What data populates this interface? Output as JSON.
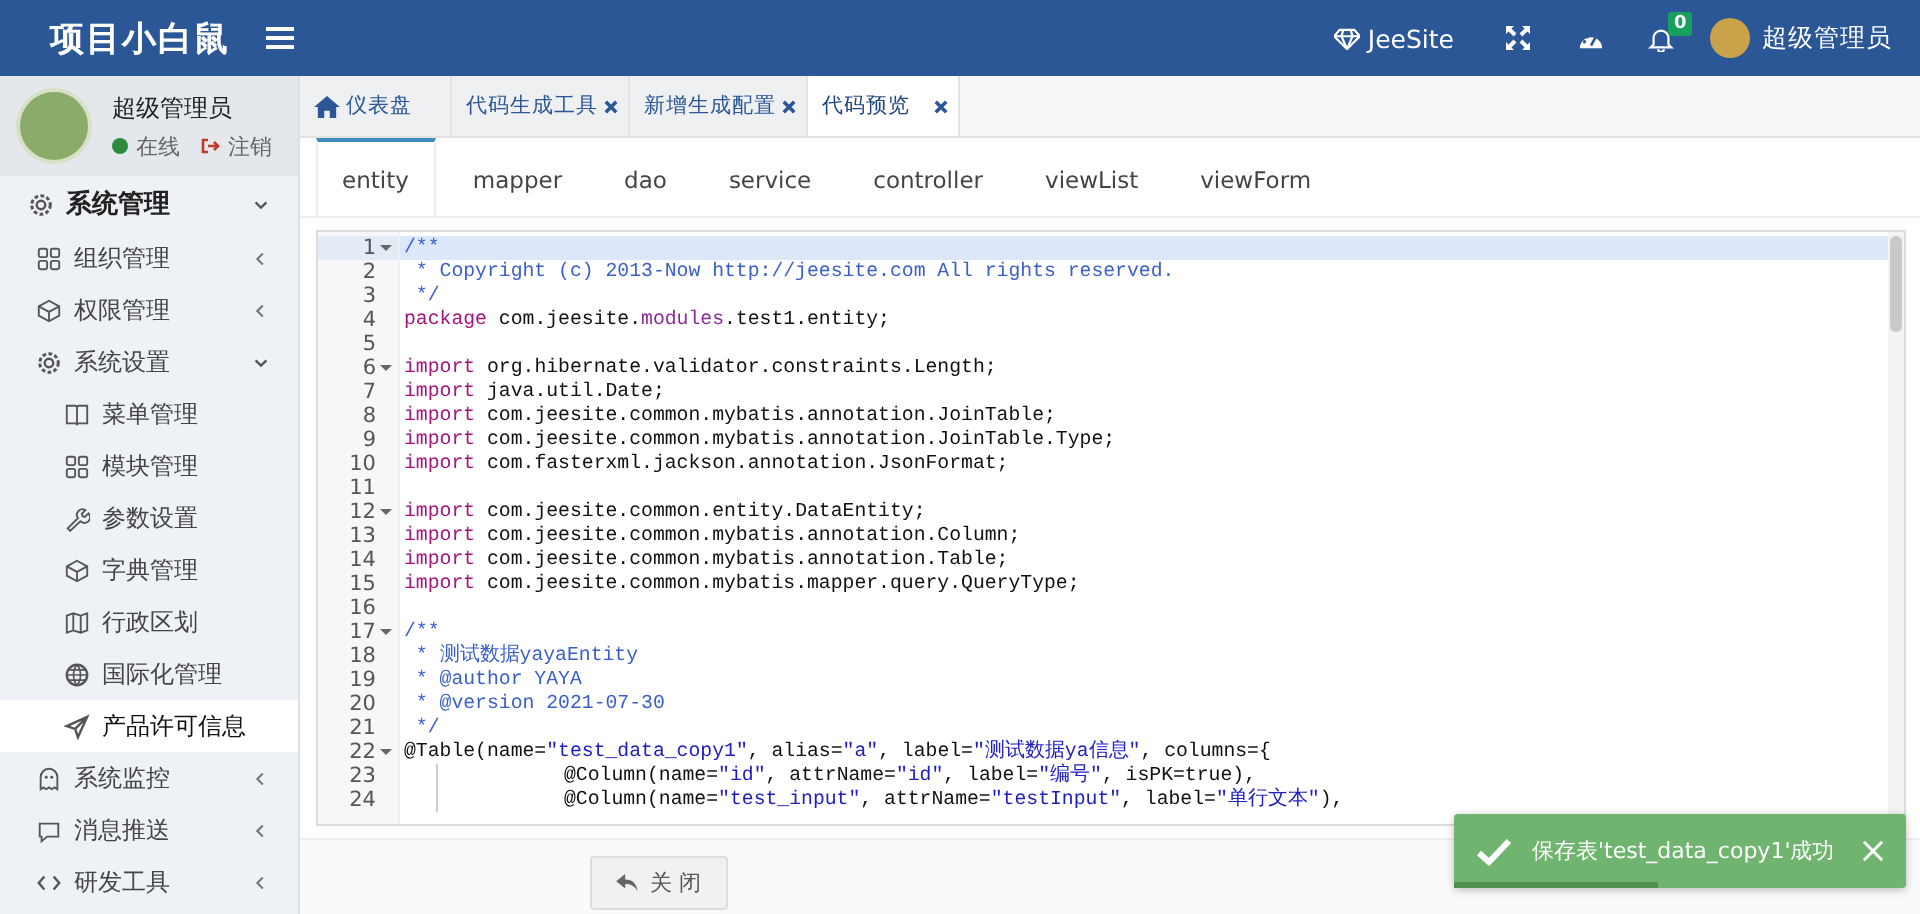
{
  "header": {
    "logo": "项目小白鼠",
    "site": "JeeSite",
    "notifications": "0",
    "user": "超级管理员"
  },
  "sidebar": {
    "user": {
      "name": "超级管理员",
      "status": "在线",
      "online": true,
      "logout": "注销"
    },
    "menu": [
      {
        "label": "系统管理",
        "kind": "gear",
        "expanded": true,
        "children": [
          {
            "label": "组织管理",
            "kind": "grid",
            "expanded": false
          },
          {
            "label": "权限管理",
            "kind": "cube",
            "expanded": false
          },
          {
            "label": "系统设置",
            "kind": "gear",
            "expanded": true,
            "children": [
              {
                "label": "菜单管理",
                "kind": "book",
                "selected": false
              },
              {
                "label": "模块管理",
                "kind": "grid",
                "selected": false
              },
              {
                "label": "参数设置",
                "kind": "wrench",
                "selected": false
              },
              {
                "label": "字典管理",
                "kind": "cube",
                "selected": false
              },
              {
                "label": "行政区划",
                "kind": "map",
                "selected": false
              },
              {
                "label": "国际化管理",
                "kind": "globe",
                "selected": false
              },
              {
                "label": "产品许可信息",
                "kind": "send",
                "selected": true
              }
            ]
          },
          {
            "label": "系统监控",
            "kind": "ghost",
            "expanded": false
          },
          {
            "label": "消息推送",
            "kind": "chat",
            "expanded": false
          },
          {
            "label": "研发工具",
            "kind": "code",
            "expanded": false
          }
        ]
      }
    ]
  },
  "tabs": [
    {
      "label": "仪表盘",
      "home": true,
      "closable": false,
      "selected": false
    },
    {
      "label": "代码生成工具",
      "home": false,
      "closable": true,
      "selected": false
    },
    {
      "label": "新增生成配置",
      "home": false,
      "closable": true,
      "selected": false
    },
    {
      "label": "代码预览",
      "home": false,
      "closable": true,
      "selected": true
    }
  ],
  "code_tabs": [
    {
      "label": "entity",
      "selected": true
    },
    {
      "label": "mapper",
      "selected": false
    },
    {
      "label": "dao",
      "selected": false
    },
    {
      "label": "service",
      "selected": false
    },
    {
      "label": "controller",
      "selected": false
    },
    {
      "label": "viewList",
      "selected": false
    },
    {
      "label": "viewForm",
      "selected": false
    }
  ],
  "editor": {
    "lines": [
      {
        "n": "1",
        "fold": true,
        "current": true,
        "indented": false,
        "tokens": [
          {
            "kind": "cm",
            "t": "/**"
          }
        ]
      },
      {
        "n": "2",
        "fold": false,
        "current": false,
        "indented": false,
        "tokens": [
          {
            "kind": "cm",
            "t": " * Copyright (c) 2013-Now http://jeesite.com All rights reserved."
          }
        ]
      },
      {
        "n": "3",
        "fold": false,
        "current": false,
        "indented": false,
        "tokens": [
          {
            "kind": "cm",
            "t": " */"
          }
        ]
      },
      {
        "n": "4",
        "fold": false,
        "current": false,
        "indented": false,
        "tokens": [
          {
            "kind": "kw",
            "t": "package"
          },
          {
            "kind": "p",
            "t": " com.jeesite."
          },
          {
            "kind": "mod",
            "t": "modules"
          },
          {
            "kind": "p",
            "t": ".test1.entity;"
          }
        ]
      },
      {
        "n": "5",
        "fold": false,
        "current": false,
        "indented": false
      },
      {
        "n": "6",
        "fold": true,
        "current": false,
        "indented": false,
        "tokens": [
          {
            "kind": "kw",
            "t": "import"
          },
          {
            "kind": "p",
            "t": " org.hibernate.validator.constraints.Length;"
          }
        ]
      },
      {
        "n": "7",
        "fold": false,
        "current": false,
        "indented": false,
        "tokens": [
          {
            "kind": "kw",
            "t": "import"
          },
          {
            "kind": "p",
            "t": " java.util.Date;"
          }
        ]
      },
      {
        "n": "8",
        "fold": false,
        "current": false,
        "indented": false,
        "tokens": [
          {
            "kind": "kw",
            "t": "import"
          },
          {
            "kind": "p",
            "t": " com.jeesite.common.mybatis.annotation.JoinTable;"
          }
        ]
      },
      {
        "n": "9",
        "fold": false,
        "current": false,
        "indented": false,
        "tokens": [
          {
            "kind": "kw",
            "t": "import"
          },
          {
            "kind": "p",
            "t": " com.jeesite.common.mybatis.annotation.JoinTable.Type;"
          }
        ]
      },
      {
        "n": "10",
        "fold": false,
        "current": false,
        "indented": false,
        "tokens": [
          {
            "kind": "kw",
            "t": "import"
          },
          {
            "kind": "p",
            "t": " com.fasterxml.jackson.annotation.JsonFormat;"
          }
        ]
      },
      {
        "n": "11",
        "fold": false,
        "current": false,
        "indented": false
      },
      {
        "n": "12",
        "fold": true,
        "current": false,
        "indented": false,
        "tokens": [
          {
            "kind": "kw",
            "t": "import"
          },
          {
            "kind": "p",
            "t": " com.jeesite.common.entity.DataEntity;"
          }
        ]
      },
      {
        "n": "13",
        "fold": false,
        "current": false,
        "indented": false,
        "tokens": [
          {
            "kind": "kw",
            "t": "import"
          },
          {
            "kind": "p",
            "t": " com.jeesite.common.mybatis.annotation.Column;"
          }
        ]
      },
      {
        "n": "14",
        "fold": false,
        "current": false,
        "indented": false,
        "tokens": [
          {
            "kind": "kw",
            "t": "import"
          },
          {
            "kind": "p",
            "t": " com.jeesite.common.mybatis.annotation.Table;"
          }
        ]
      },
      {
        "n": "15",
        "fold": false,
        "current": false,
        "indented": false,
        "tokens": [
          {
            "kind": "kw",
            "t": "import"
          },
          {
            "kind": "p",
            "t": " com.jeesite.common.mybatis.mapper.query.QueryType;"
          }
        ]
      },
      {
        "n": "16",
        "fold": false,
        "current": false,
        "indented": false
      },
      {
        "n": "17",
        "fold": true,
        "current": false,
        "indented": false,
        "tokens": [
          {
            "kind": "cm",
            "t": "/**"
          }
        ]
      },
      {
        "n": "18",
        "fold": false,
        "current": false,
        "indented": false,
        "tokens": [
          {
            "kind": "cm",
            "t": " * 测试数据yayaEntity"
          }
        ]
      },
      {
        "n": "19",
        "fold": false,
        "current": false,
        "indented": false,
        "tokens": [
          {
            "kind": "cm",
            "t": " * @author YAYA"
          }
        ]
      },
      {
        "n": "20",
        "fold": false,
        "current": false,
        "indented": false,
        "tokens": [
          {
            "kind": "cm",
            "t": " * @version 2021-07-30"
          }
        ]
      },
      {
        "n": "21",
        "fold": false,
        "current": false,
        "indented": false,
        "tokens": [
          {
            "kind": "cm",
            "t": " */"
          }
        ]
      },
      {
        "n": "22",
        "fold": true,
        "current": false,
        "indented": false,
        "tokens": [
          {
            "kind": "p",
            "t": "@Table(name="
          },
          {
            "kind": "str",
            "t": "\"test_data_copy1\""
          },
          {
            "kind": "p",
            "t": ", alias="
          },
          {
            "kind": "str",
            "t": "\"a\""
          },
          {
            "kind": "p",
            "t": ", label="
          },
          {
            "kind": "str",
            "t": "\"测试数据ya信息\""
          },
          {
            "kind": "p",
            "t": ", columns={"
          }
        ]
      },
      {
        "n": "23",
        "fold": false,
        "current": false,
        "indented": true,
        "tokens": [
          {
            "kind": "p",
            "t": "@Column(name="
          },
          {
            "kind": "str",
            "t": "\"id\""
          },
          {
            "kind": "p",
            "t": ", attrName="
          },
          {
            "kind": "str",
            "t": "\"id\""
          },
          {
            "kind": "p",
            "t": ", label="
          },
          {
            "kind": "str",
            "t": "\"编号\""
          },
          {
            "kind": "p",
            "t": ", isPK=true),"
          }
        ]
      },
      {
        "n": "24",
        "fold": false,
        "current": false,
        "indented": true,
        "tokens": [
          {
            "kind": "p",
            "t": "@Column(name="
          },
          {
            "kind": "str",
            "t": "\"test_input\""
          },
          {
            "kind": "p",
            "t": ", attrName="
          },
          {
            "kind": "str",
            "t": "\"testInput\""
          },
          {
            "kind": "p",
            "t": ", label="
          },
          {
            "kind": "str",
            "t": "\"单行文本\""
          },
          {
            "kind": "p",
            "t": "),"
          }
        ]
      }
    ]
  },
  "footer": {
    "close_button": "关 闭"
  },
  "toast": {
    "message": "保存表'test_data_copy1'成功",
    "level": 0.45
  }
}
